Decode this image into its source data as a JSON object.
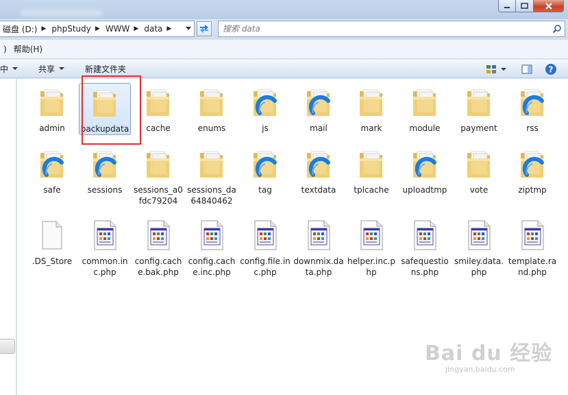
{
  "window": {
    "colors": {
      "selection": "#d1e4fa",
      "callout": "#e12f2f",
      "accent": "#1a7de0"
    }
  },
  "address": {
    "crumbs": [
      "磁盘 (D:)",
      "phpStudy",
      "WWW",
      "data"
    ],
    "search_placeholder": "搜索 data"
  },
  "menu": {
    "items": [
      ")",
      "帮助(H)"
    ]
  },
  "toolbar": {
    "organize": "中",
    "share": "共享",
    "new_folder": "新建文件夹"
  },
  "rows": [
    [
      {
        "name": "admin",
        "icon": "folder-icon"
      },
      {
        "name": "backupdata",
        "icon": "folder-icon",
        "selected": true
      },
      {
        "name": "cache",
        "icon": "folder-icon"
      },
      {
        "name": "enums",
        "icon": "folder-icon"
      },
      {
        "name": "js",
        "icon": "folder-sync-icon"
      },
      {
        "name": "mail",
        "icon": "folder-sync-icon"
      },
      {
        "name": "mark",
        "icon": "folder-icon"
      },
      {
        "name": "module",
        "icon": "folder-icon"
      },
      {
        "name": "payment",
        "icon": "folder-icon"
      },
      {
        "name": "rss",
        "icon": "folder-sync-icon"
      }
    ],
    [
      {
        "name": "safe",
        "icon": "folder-sync-icon"
      },
      {
        "name": "sessions",
        "icon": "folder-sync-icon"
      },
      {
        "name": "sessions_a0fdc79204",
        "icon": "folder-icon"
      },
      {
        "name": "sessions_da64840462",
        "icon": "folder-icon"
      },
      {
        "name": "tag",
        "icon": "folder-sync-icon"
      },
      {
        "name": "textdata",
        "icon": "folder-sync-icon"
      },
      {
        "name": "tplcache",
        "icon": "folder-icon"
      },
      {
        "name": "uploadtmp",
        "icon": "folder-sync-icon"
      },
      {
        "name": "vote",
        "icon": "folder-icon"
      },
      {
        "name": "ziptmp",
        "icon": "folder-sync-icon"
      }
    ],
    [
      {
        "name": ".DS_Store",
        "icon": "blank-file-icon"
      },
      {
        "name": "common.inc.php",
        "icon": "php-file-icon"
      },
      {
        "name": "config.cache.bak.php",
        "icon": "php-file-icon"
      },
      {
        "name": "config.cache.inc.php",
        "icon": "php-file-icon"
      },
      {
        "name": "config.file.inc.php",
        "icon": "php-file-icon"
      },
      {
        "name": "downmix.data.php",
        "icon": "php-file-icon"
      },
      {
        "name": "helper.inc.php",
        "icon": "php-file-icon"
      },
      {
        "name": "safequestions.php",
        "icon": "php-file-icon"
      },
      {
        "name": "smiley.data.php",
        "icon": "php-file-icon"
      },
      {
        "name": "template.rand.php",
        "icon": "php-file-icon"
      }
    ]
  ],
  "watermark": {
    "main": "Bai du 经验",
    "sub": "jingyan.baidu.com"
  }
}
